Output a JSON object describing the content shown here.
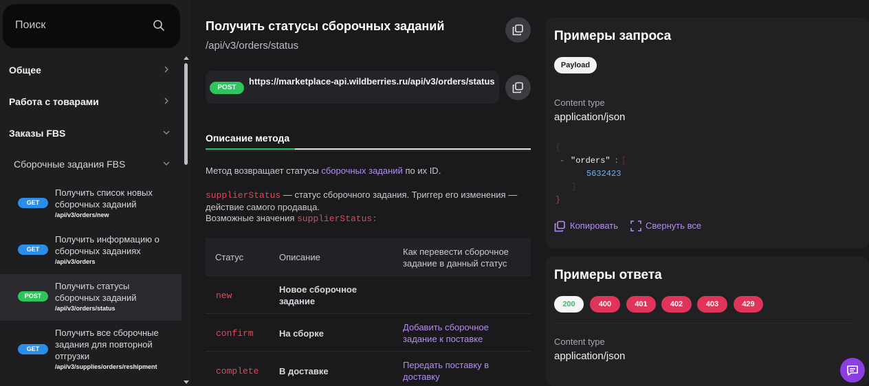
{
  "search": {
    "placeholder": "Поиск",
    "icon": "search-icon"
  },
  "sidebar": {
    "sections": [
      {
        "label": "Общее",
        "state": "collapsed"
      },
      {
        "label": "Работа с товарами",
        "state": "collapsed"
      },
      {
        "label": "Заказы FBS",
        "state": "expanded"
      }
    ],
    "subsection": {
      "label": "Сборочные задания FBS",
      "state": "expanded"
    },
    "methods": [
      {
        "method": "GET",
        "title": "Получить список новых сборочных заданий",
        "path": "/api/v3/orders/new"
      },
      {
        "method": "GET",
        "title": "Получить информацию о сборочных заданиях",
        "path": "/api/v3/orders"
      },
      {
        "method": "POST",
        "title": "Получить статусы сборочных заданий",
        "path": "/api/v3/orders/status",
        "active": true
      },
      {
        "method": "GET",
        "title": "Получить все сборочные задания для повторной отгрузки",
        "path": "/api/v3/supplies/orders/reshipment"
      }
    ]
  },
  "main": {
    "title": "Получить статусы сборочных заданий",
    "path": "/api/v3/orders/status",
    "method": "POST",
    "url": "https://marketplace-api.wildberries.ru/api/v3/orders/status",
    "tab": "Описание метода",
    "desc1_before": "Метод возвращает статусы ",
    "desc1_link": "сборочных заданий",
    "desc1_after": " по их ID.",
    "desc2_code": "supplierStatus",
    "desc2_text": " — статус сборочного задания. Триггер его изменения — действие самого продавца.",
    "desc3_text": "Возможные значения ",
    "desc3_code": "supplierStatus",
    "desc3_after": ":",
    "table": {
      "headers": [
        "Статус",
        "Описание",
        "Как перевести сборочное задание в данный статус"
      ],
      "rows": [
        {
          "status": "new",
          "description": "Новое сборочное задание",
          "action": ""
        },
        {
          "status": "confirm",
          "description": "На сборке",
          "action": "Добавить сборочное задание к поставке"
        },
        {
          "status": "complete",
          "description": "В доставке",
          "action": "Передать поставку в доставку"
        }
      ]
    }
  },
  "request": {
    "title": "Примеры запроса",
    "tab": "Payload",
    "content_type_label": "Content type",
    "content_type": "application/json",
    "json": {
      "open": "{",
      "dash": "-",
      "key": "\"orders\"",
      "colon": ":",
      "arr_open": "[",
      "value": "5632423",
      "arr_close": "]",
      "close": "}"
    },
    "copy": "Копировать",
    "collapse": "Свернуть все"
  },
  "response": {
    "title": "Примеры ответа",
    "codes": [
      "200",
      "400",
      "401",
      "402",
      "403",
      "429"
    ],
    "selected": "200",
    "content_type_label": "Content type",
    "content_type": "application/json"
  },
  "colors": {
    "accent": "#b58cf0",
    "get": "#2a8de8",
    "post": "#2ec45e",
    "error": "#e0355a",
    "code_red": "#e0475c"
  }
}
